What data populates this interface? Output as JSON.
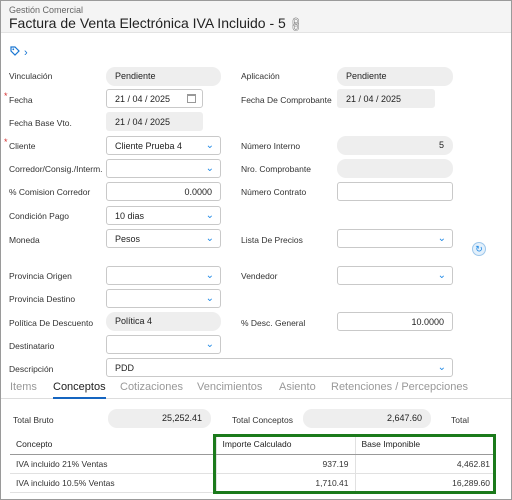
{
  "header": {
    "module": "Gestión Comercial",
    "title": "Factura de Venta Electrónica IVA Incluido - 5"
  },
  "form": {
    "vinculacion": {
      "label": "Vinculación",
      "value": "Pendiente"
    },
    "aplicacion": {
      "label": "Aplicación",
      "value": "Pendiente"
    },
    "fecha": {
      "label": "Fecha",
      "value": "21 / 04 / 2025"
    },
    "fecha_comprobante": {
      "label": "Fecha De Comprobante",
      "value": "21 / 04 / 2025"
    },
    "fecha_base_vto": {
      "label": "Fecha Base Vto.",
      "value": "21 / 04 / 2025"
    },
    "cliente": {
      "label": "Cliente",
      "value": "Cliente Prueba 4"
    },
    "numero_interno": {
      "label": "Número Interno",
      "value": "5"
    },
    "corredor": {
      "label": "Corredor/Consig./Interm.",
      "value": ""
    },
    "nro_comprobante": {
      "label": "Nro. Comprobante",
      "value": ""
    },
    "comision_corredor": {
      "label": "% Comision Corredor",
      "value": "0.0000"
    },
    "numero_contrato": {
      "label": "Número Contrato",
      "value": ""
    },
    "condicion_pago": {
      "label": "Condición Pago",
      "value": "10 dias"
    },
    "moneda": {
      "label": "Moneda",
      "value": "Pesos"
    },
    "lista_precios": {
      "label": "Lista De Precios",
      "value": ""
    },
    "provincia_origen": {
      "label": "Provincia Origen",
      "value": ""
    },
    "vendedor": {
      "label": "Vendedor",
      "value": ""
    },
    "provincia_destino": {
      "label": "Provincia Destino",
      "value": ""
    },
    "politica_descuento": {
      "label": "Política De Descuento",
      "value": "Política 4"
    },
    "desc_general": {
      "label": "% Desc. General",
      "value": "10.0000"
    },
    "destinatario": {
      "label": "Destinatario",
      "value": ""
    },
    "descripcion": {
      "label": "Descripción",
      "value": "PDD"
    }
  },
  "tabs": [
    "Items",
    "Conceptos",
    "Cotizaciones",
    "Vencimientos",
    "Asiento",
    "Retenciones / Percepciones"
  ],
  "totals": {
    "total_bruto_label": "Total Bruto",
    "total_bruto": "25,252.41",
    "total_conceptos_label": "Total Conceptos",
    "total_conceptos": "2,647.60",
    "total_label": "Total"
  },
  "grid": {
    "headers": [
      "Concepto",
      "Importe Calculado",
      "Base Imponible"
    ],
    "rows": [
      {
        "concepto": "IVA incluido 21% Ventas",
        "importe": "937.19",
        "base": "4,462.81"
      },
      {
        "concepto": "IVA incluido 10.5% Ventas",
        "importe": "1,710.41",
        "base": "16,289.60"
      }
    ]
  },
  "colors": {
    "accent": "#1e88e5",
    "highlight": "#1b7a1b"
  }
}
